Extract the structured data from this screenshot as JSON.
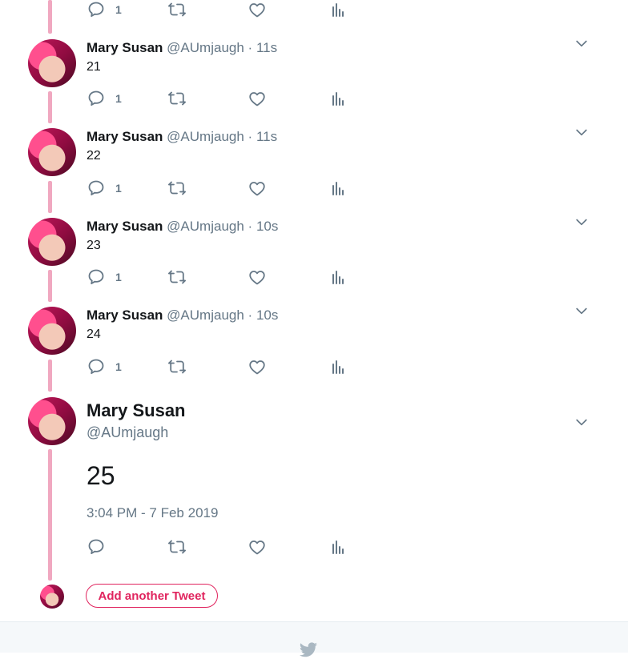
{
  "colors": {
    "accent": "#e0245e",
    "thread": "#f0a8c0",
    "muted": "#657786"
  },
  "top_actions": {
    "reply_count": "1"
  },
  "tweets": [
    {
      "name": "Mary Susan",
      "handle": "@AUmjaugh",
      "dot": "·",
      "time": "11s",
      "text": "21",
      "reply_count": "1"
    },
    {
      "name": "Mary Susan",
      "handle": "@AUmjaugh",
      "dot": "·",
      "time": "11s",
      "text": "22",
      "reply_count": "1"
    },
    {
      "name": "Mary Susan",
      "handle": "@AUmjaugh",
      "dot": "·",
      "time": "10s",
      "text": "23",
      "reply_count": "1"
    },
    {
      "name": "Mary Susan",
      "handle": "@AUmjaugh",
      "dot": "·",
      "time": "10s",
      "text": "24",
      "reply_count": "1"
    }
  ],
  "focused": {
    "name": "Mary Susan",
    "handle": "@AUmjaugh",
    "text": "25",
    "timestamp": "3:04 PM - 7 Feb 2019"
  },
  "compose": {
    "add_label": "Add another Tweet"
  },
  "icons": [
    "reply-icon",
    "retweet-icon",
    "like-icon",
    "analytics-icon",
    "chevron-down-icon",
    "twitter-bird-icon"
  ]
}
